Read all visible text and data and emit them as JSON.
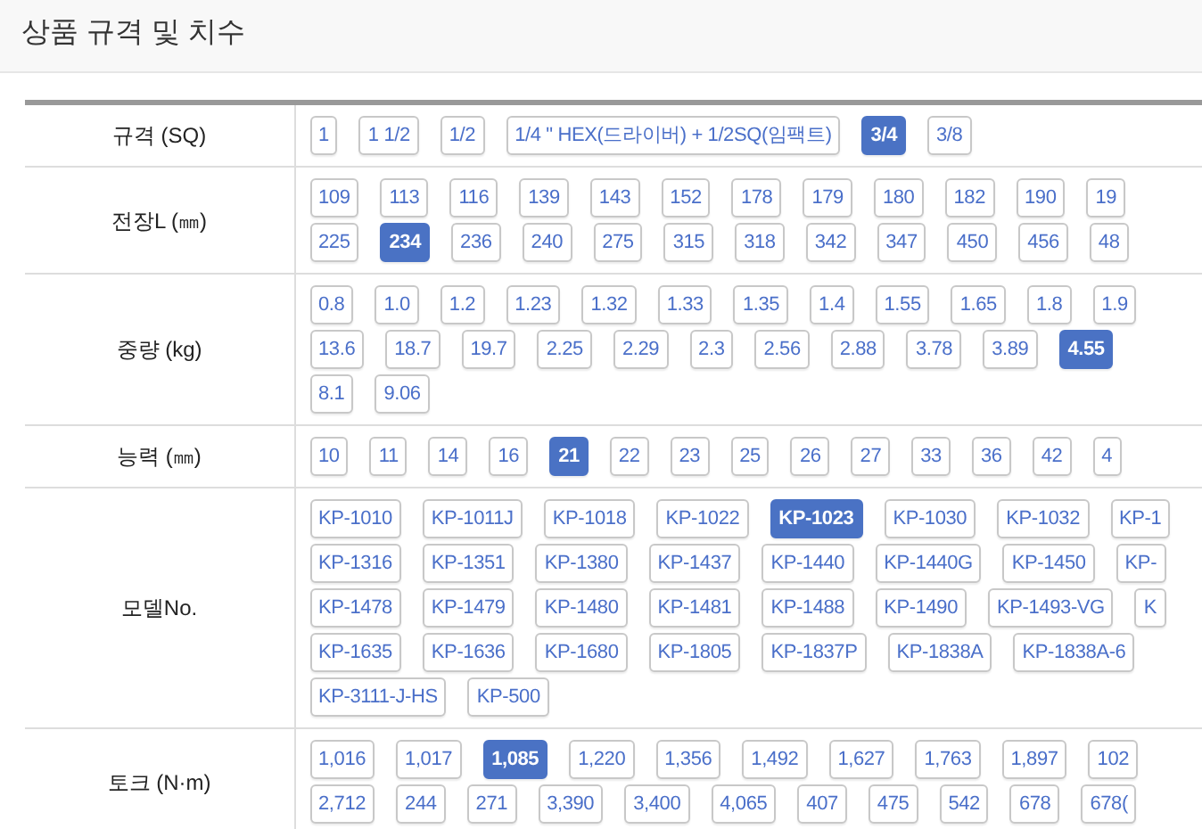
{
  "title": "상품 규격 및 치수",
  "rows": [
    {
      "label": "규격 (SQ)",
      "lines": [
        [
          {
            "text": "1",
            "selected": false
          },
          {
            "text": "1 1/2",
            "selected": false
          },
          {
            "text": "1/2",
            "selected": false
          },
          {
            "text": "1/4 \" HEX(드라이버) + 1/2SQ(임팩트)",
            "selected": false
          },
          {
            "text": "3/4",
            "selected": true
          },
          {
            "text": "3/8",
            "selected": false
          }
        ]
      ]
    },
    {
      "label": "전장L (㎜)",
      "lines": [
        [
          {
            "text": "109",
            "selected": false
          },
          {
            "text": "113",
            "selected": false
          },
          {
            "text": "116",
            "selected": false
          },
          {
            "text": "139",
            "selected": false
          },
          {
            "text": "143",
            "selected": false
          },
          {
            "text": "152",
            "selected": false
          },
          {
            "text": "178",
            "selected": false
          },
          {
            "text": "179",
            "selected": false
          },
          {
            "text": "180",
            "selected": false
          },
          {
            "text": "182",
            "selected": false
          },
          {
            "text": "190",
            "selected": false
          },
          {
            "text": "19",
            "selected": false
          }
        ],
        [
          {
            "text": "225",
            "selected": false
          },
          {
            "text": "234",
            "selected": true
          },
          {
            "text": "236",
            "selected": false
          },
          {
            "text": "240",
            "selected": false
          },
          {
            "text": "275",
            "selected": false
          },
          {
            "text": "315",
            "selected": false
          },
          {
            "text": "318",
            "selected": false
          },
          {
            "text": "342",
            "selected": false
          },
          {
            "text": "347",
            "selected": false
          },
          {
            "text": "450",
            "selected": false
          },
          {
            "text": "456",
            "selected": false
          },
          {
            "text": "48",
            "selected": false
          }
        ]
      ]
    },
    {
      "label": "중량 (kg)",
      "lines": [
        [
          {
            "text": "0.8",
            "selected": false
          },
          {
            "text": "1.0",
            "selected": false
          },
          {
            "text": "1.2",
            "selected": false
          },
          {
            "text": "1.23",
            "selected": false
          },
          {
            "text": "1.32",
            "selected": false
          },
          {
            "text": "1.33",
            "selected": false
          },
          {
            "text": "1.35",
            "selected": false
          },
          {
            "text": "1.4",
            "selected": false
          },
          {
            "text": "1.55",
            "selected": false
          },
          {
            "text": "1.65",
            "selected": false
          },
          {
            "text": "1.8",
            "selected": false
          },
          {
            "text": "1.9",
            "selected": false
          }
        ],
        [
          {
            "text": "13.6",
            "selected": false
          },
          {
            "text": "18.7",
            "selected": false
          },
          {
            "text": "19.7",
            "selected": false
          },
          {
            "text": "2.25",
            "selected": false
          },
          {
            "text": "2.29",
            "selected": false
          },
          {
            "text": "2.3",
            "selected": false
          },
          {
            "text": "2.56",
            "selected": false
          },
          {
            "text": "2.88",
            "selected": false
          },
          {
            "text": "3.78",
            "selected": false
          },
          {
            "text": "3.89",
            "selected": false
          },
          {
            "text": "4.55",
            "selected": true
          }
        ],
        [
          {
            "text": "8.1",
            "selected": false
          },
          {
            "text": "9.06",
            "selected": false
          }
        ]
      ]
    },
    {
      "label": "능력 (㎜)",
      "lines": [
        [
          {
            "text": "10",
            "selected": false
          },
          {
            "text": "11",
            "selected": false
          },
          {
            "text": "14",
            "selected": false
          },
          {
            "text": "16",
            "selected": false
          },
          {
            "text": "21",
            "selected": true
          },
          {
            "text": "22",
            "selected": false
          },
          {
            "text": "23",
            "selected": false
          },
          {
            "text": "25",
            "selected": false
          },
          {
            "text": "26",
            "selected": false
          },
          {
            "text": "27",
            "selected": false
          },
          {
            "text": "33",
            "selected": false
          },
          {
            "text": "36",
            "selected": false
          },
          {
            "text": "42",
            "selected": false
          },
          {
            "text": "4",
            "selected": false
          }
        ]
      ]
    },
    {
      "label": "모델No.",
      "lines": [
        [
          {
            "text": "KP-1010",
            "selected": false
          },
          {
            "text": "KP-1011J",
            "selected": false
          },
          {
            "text": "KP-1018",
            "selected": false
          },
          {
            "text": "KP-1022",
            "selected": false
          },
          {
            "text": "KP-1023",
            "selected": true
          },
          {
            "text": "KP-1030",
            "selected": false
          },
          {
            "text": "KP-1032",
            "selected": false
          },
          {
            "text": "KP-1",
            "selected": false
          }
        ],
        [
          {
            "text": "KP-1316",
            "selected": false
          },
          {
            "text": "KP-1351",
            "selected": false
          },
          {
            "text": "KP-1380",
            "selected": false
          },
          {
            "text": "KP-1437",
            "selected": false
          },
          {
            "text": "KP-1440",
            "selected": false
          },
          {
            "text": "KP-1440G",
            "selected": false
          },
          {
            "text": "KP-1450",
            "selected": false
          },
          {
            "text": "KP-",
            "selected": false
          }
        ],
        [
          {
            "text": "KP-1478",
            "selected": false
          },
          {
            "text": "KP-1479",
            "selected": false
          },
          {
            "text": "KP-1480",
            "selected": false
          },
          {
            "text": "KP-1481",
            "selected": false
          },
          {
            "text": "KP-1488",
            "selected": false
          },
          {
            "text": "KP-1490",
            "selected": false
          },
          {
            "text": "KP-1493-VG",
            "selected": false
          },
          {
            "text": "K",
            "selected": false
          }
        ],
        [
          {
            "text": "KP-1635",
            "selected": false
          },
          {
            "text": "KP-1636",
            "selected": false
          },
          {
            "text": "KP-1680",
            "selected": false
          },
          {
            "text": "KP-1805",
            "selected": false
          },
          {
            "text": "KP-1837P",
            "selected": false
          },
          {
            "text": "KP-1838A",
            "selected": false
          },
          {
            "text": "KP-1838A-6",
            "selected": false
          }
        ],
        [
          {
            "text": "KP-3111-J-HS",
            "selected": false
          },
          {
            "text": "KP-500",
            "selected": false
          }
        ]
      ]
    },
    {
      "label": "토크 (N·m)",
      "lines": [
        [
          {
            "text": "1,016",
            "selected": false
          },
          {
            "text": "1,017",
            "selected": false
          },
          {
            "text": "1,085",
            "selected": true
          },
          {
            "text": "1,220",
            "selected": false
          },
          {
            "text": "1,356",
            "selected": false
          },
          {
            "text": "1,492",
            "selected": false
          },
          {
            "text": "1,627",
            "selected": false
          },
          {
            "text": "1,763",
            "selected": false
          },
          {
            "text": "1,897",
            "selected": false
          },
          {
            "text": "102",
            "selected": false
          }
        ],
        [
          {
            "text": "2,712",
            "selected": false
          },
          {
            "text": "244",
            "selected": false
          },
          {
            "text": "271",
            "selected": false
          },
          {
            "text": "3,390",
            "selected": false
          },
          {
            "text": "3,400",
            "selected": false
          },
          {
            "text": "4,065",
            "selected": false
          },
          {
            "text": "407",
            "selected": false
          },
          {
            "text": "475",
            "selected": false
          },
          {
            "text": "542",
            "selected": false
          },
          {
            "text": "678",
            "selected": false
          },
          {
            "text": "678(",
            "selected": false
          }
        ]
      ]
    }
  ]
}
